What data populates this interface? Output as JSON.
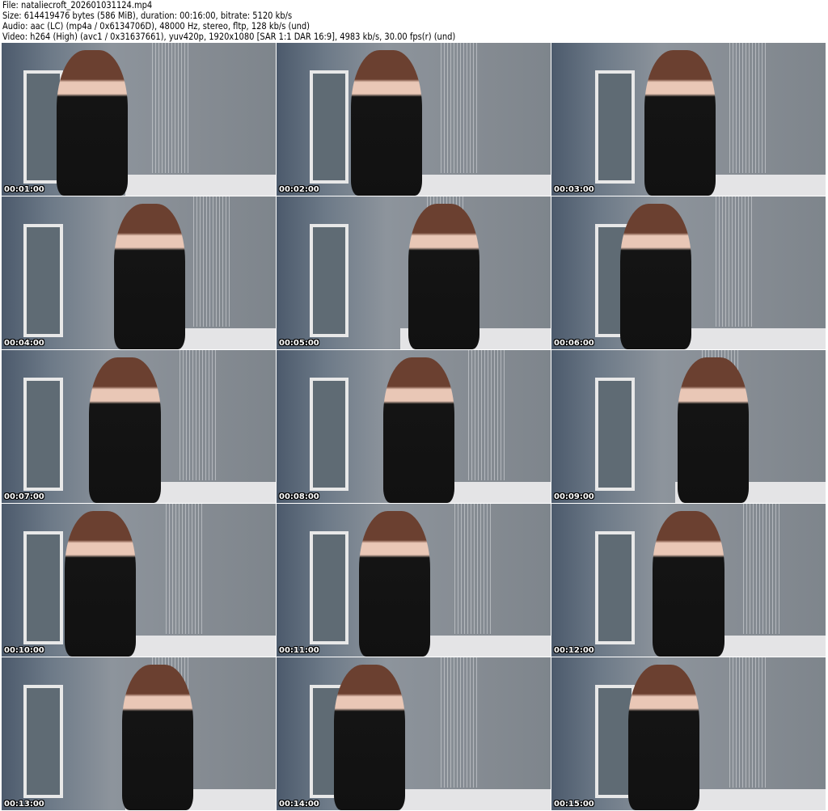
{
  "header": {
    "file": "File: nataliecroft_202601031124.mp4",
    "size": "Size: 614419476 bytes (586 MiB), duration: 00:16:00, bitrate: 5120 kb/s",
    "audio": "Audio: aac (LC) (mp4a / 0x6134706D), 48000 Hz, stereo, fltp, 128 kb/s (und)",
    "video": "Video: h264 (High) (avc1 / 0x31637661), yuv420p, 1920x1080 [SAR 1:1 DAR 16:9], 4983 kb/s, 30.00 fps(r) (und)"
  },
  "thumbnails": [
    {
      "timestamp": "00:01:00"
    },
    {
      "timestamp": "00:02:00"
    },
    {
      "timestamp": "00:03:00"
    },
    {
      "timestamp": "00:04:00"
    },
    {
      "timestamp": "00:05:00"
    },
    {
      "timestamp": "00:06:00"
    },
    {
      "timestamp": "00:07:00"
    },
    {
      "timestamp": "00:08:00"
    },
    {
      "timestamp": "00:09:00"
    },
    {
      "timestamp": "00:10:00"
    },
    {
      "timestamp": "00:11:00"
    },
    {
      "timestamp": "00:12:00"
    },
    {
      "timestamp": "00:13:00"
    },
    {
      "timestamp": "00:14:00"
    },
    {
      "timestamp": "00:15:00"
    }
  ]
}
